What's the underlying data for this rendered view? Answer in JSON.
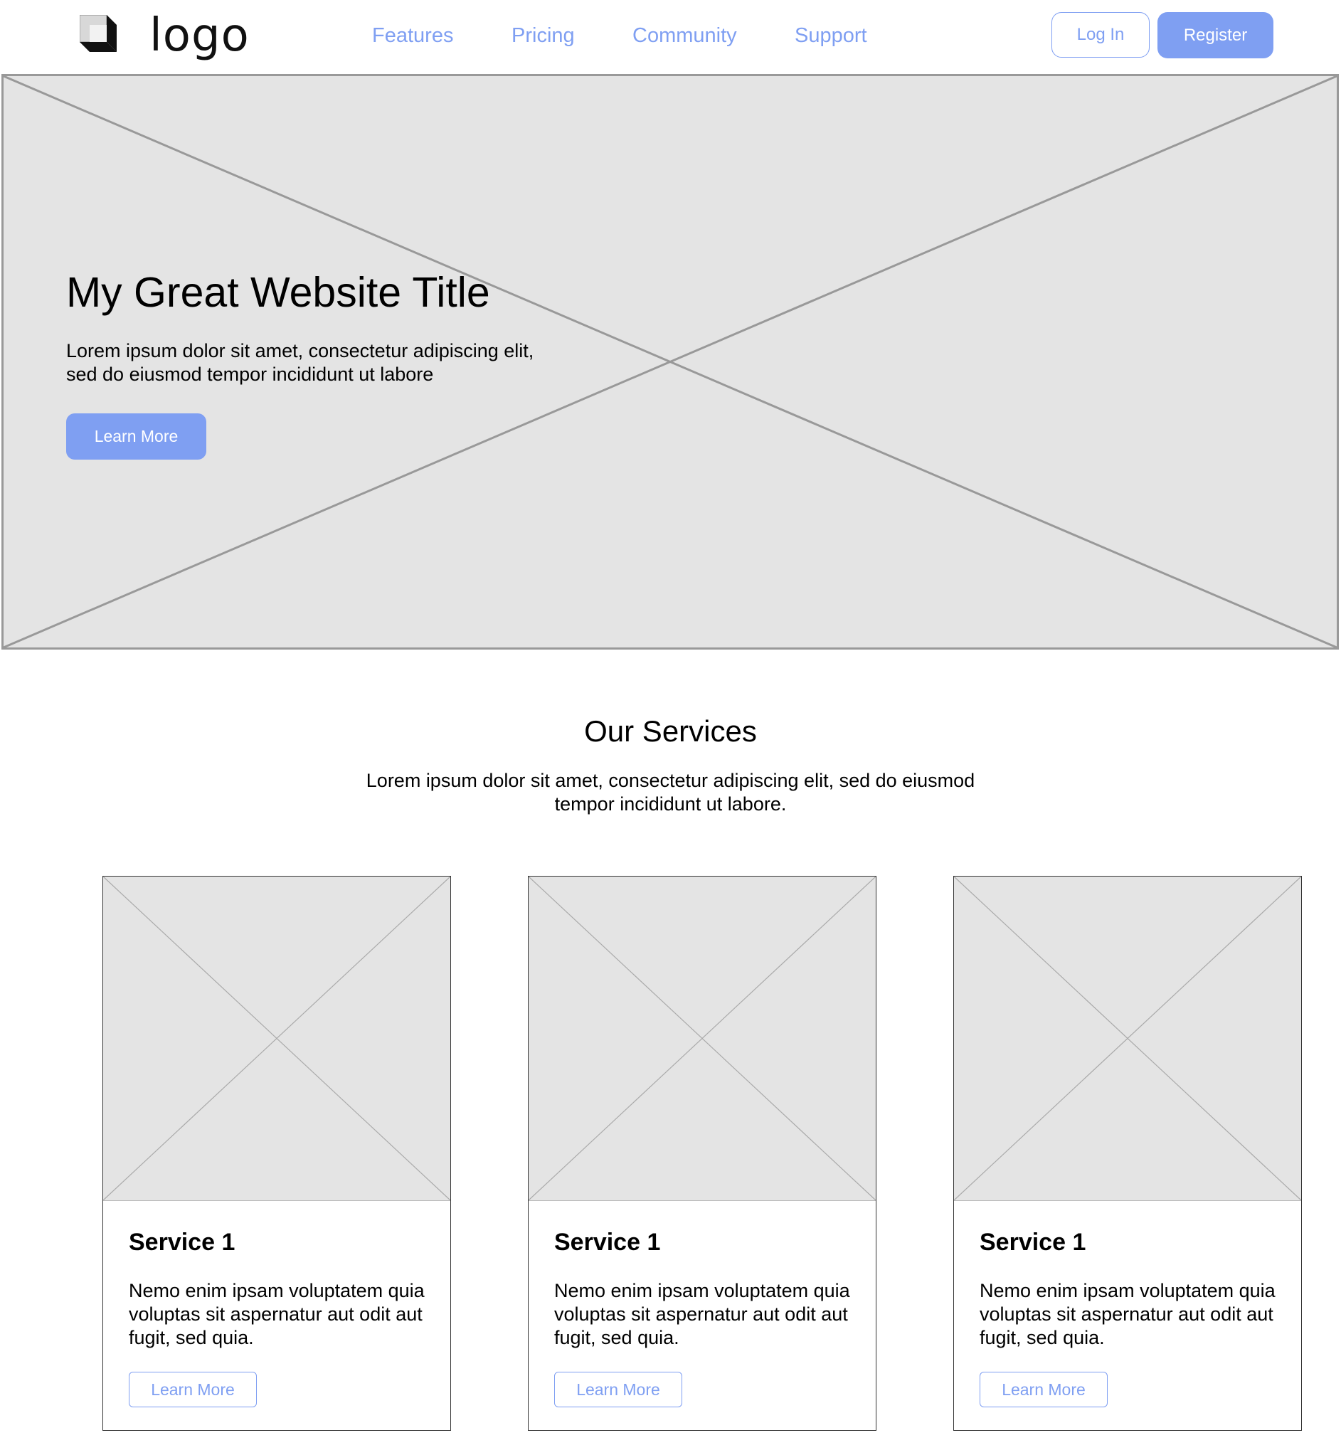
{
  "header": {
    "logo_text": "logo",
    "nav": [
      {
        "label": "Features"
      },
      {
        "label": "Pricing"
      },
      {
        "label": "Community"
      },
      {
        "label": "Support"
      }
    ],
    "login_label": "Log In",
    "register_label": "Register"
  },
  "hero": {
    "title": "My Great Website Title",
    "text": "Lorem ipsum dolor sit amet, consectetur adipiscing elit, sed do eiusmod tempor incididunt ut labore",
    "button_label": "Learn More"
  },
  "services": {
    "title": "Our Services",
    "text": "Lorem ipsum dolor sit amet, consectetur adipiscing elit, sed do eiusmod tempor incididunt ut labore.",
    "cards": [
      {
        "title": "Service 1",
        "text": "Nemo enim ipsam voluptatem quia voluptas sit aspernatur aut odit aut fugit, sed quia.",
        "button_label": "Learn More"
      },
      {
        "title": "Service 1",
        "text": "Nemo enim ipsam voluptatem quia voluptas sit aspernatur aut odit aut fugit, sed quia.",
        "button_label": "Learn More"
      },
      {
        "title": "Service 1",
        "text": "Nemo enim ipsam voluptatem quia voluptas sit aspernatur aut odit aut fugit, sed quia.",
        "button_label": "Learn More"
      }
    ]
  },
  "colors": {
    "accent": "#7f9ff2",
    "placeholder_fill": "#e4e4e4",
    "placeholder_stroke": "#999999"
  },
  "icons": {
    "logo": "cube-logo-icon",
    "image_placeholder": "image-placeholder-icon"
  }
}
